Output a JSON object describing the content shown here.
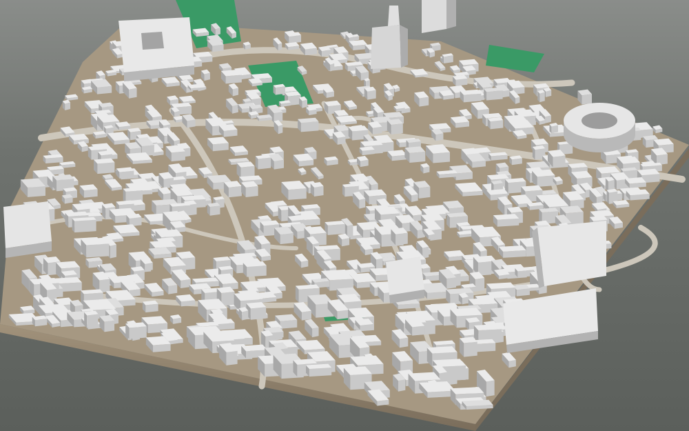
{
  "scene": {
    "type": "3d-city-massing-model",
    "colors": {
      "background_top": "#8a8d8a",
      "background_bottom": "#5b5f5b",
      "base_side": "#9a8c76",
      "base_side_dark": "#7f725f",
      "ground": "#a69882",
      "street": "#c8c2b6",
      "park": "#3a9a66",
      "roof": "#e9e9e9",
      "wall_light": "#cfcfcf",
      "wall_dark": "#a9a9a9"
    }
  }
}
